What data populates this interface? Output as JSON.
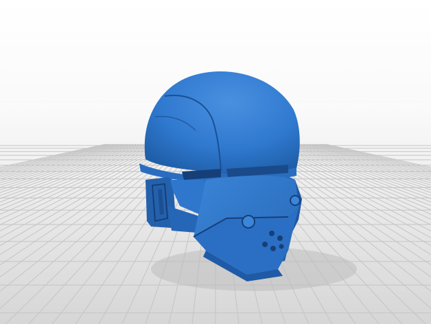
{
  "scene": {
    "subject": "helmet-model",
    "colors": {
      "background": "#ffffff",
      "floor_light": "#f3f3f3",
      "floor_dark": "#cfcfcf",
      "grid_line": "#bdbdbd",
      "model_base": "#2f79cf",
      "model_light": "#5a9ae0",
      "model_dark": "#1b4f93",
      "model_shadow": "#123a70",
      "floor_shadow": "#c7c7c7"
    },
    "icons": [
      "helmet-model",
      "build-plate-grid"
    ]
  }
}
